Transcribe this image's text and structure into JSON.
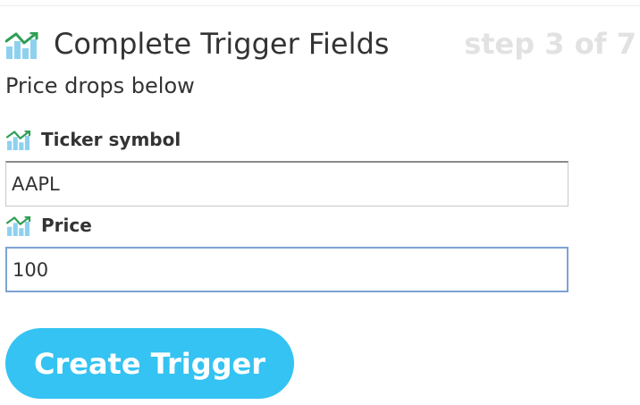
{
  "header": {
    "title": "Complete Trigger Fields",
    "step": "step 3 of 7",
    "icon": "stocks-chart-icon"
  },
  "trigger": {
    "name": "Price drops below"
  },
  "fields": [
    {
      "label": "Ticker symbol",
      "value": "AAPL",
      "icon": "stocks-chart-icon"
    },
    {
      "label": "Price",
      "value": "100",
      "icon": "stocks-chart-icon"
    }
  ],
  "actions": {
    "create_label": "Create Trigger"
  },
  "colors": {
    "button": "#34c3f2",
    "step_text": "#e2e2e2",
    "chart_bars": "#8ed1ef",
    "chart_line": "#2f9e55",
    "focus_border": "#7da3d3"
  }
}
